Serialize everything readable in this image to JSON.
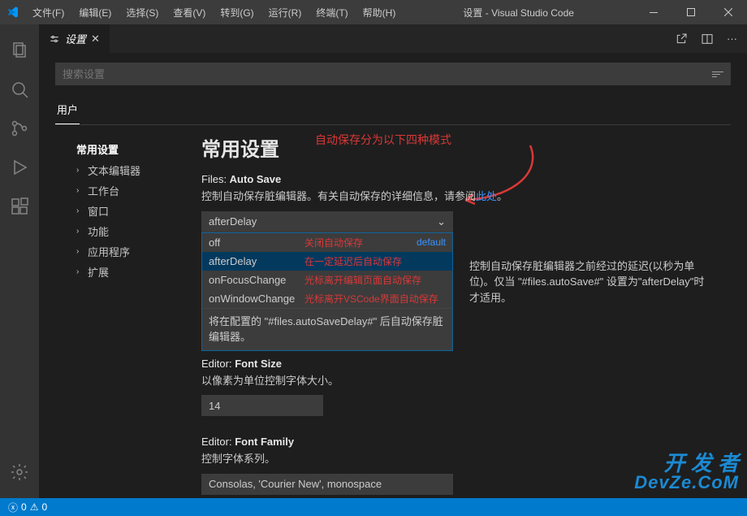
{
  "window": {
    "title": "设置 - Visual Studio Code"
  },
  "menu": [
    "文件(F)",
    "编辑(E)",
    "选择(S)",
    "查看(V)",
    "转到(G)",
    "运行(R)",
    "终端(T)",
    "帮助(H)"
  ],
  "tab": {
    "label": "设置"
  },
  "search": {
    "placeholder": "搜索设置"
  },
  "scope": {
    "user": "用户"
  },
  "toc": {
    "header": "常用设置",
    "items": [
      "文本编辑器",
      "工作台",
      "窗口",
      "功能",
      "应用程序",
      "扩展"
    ]
  },
  "group_title": "常用设置",
  "annotations": {
    "headline": "自动保存分为以下四种模式"
  },
  "autosave": {
    "label_cat": "Files: ",
    "label_name": "Auto Save",
    "desc_before": "控制自动保存脏编辑器。有关自动保存的详细信息，请参阅",
    "desc_link": "此处",
    "desc_after": "。",
    "value": "afterDelay",
    "options": [
      {
        "name": "off",
        "annot": "关闭自动保存",
        "default": "default"
      },
      {
        "name": "afterDelay",
        "annot": "在一定延迟后自动保存"
      },
      {
        "name": "onFocusChange",
        "annot": "光标离开编辑页面自动保存"
      },
      {
        "name": "onWindowChange",
        "annot": "光标离开VSCode界面自动保存"
      }
    ],
    "info": "将在配置的 \"#files.autoSaveDelay#\" 后自动保存脏编辑器。"
  },
  "autosave_delay": {
    "desc": "控制自动保存脏编辑器之前经过的延迟(以秒为单位)。仅当 \"#files.autoSave#\" 设置为\"afterDelay\"时才适用。"
  },
  "fontsize": {
    "label_cat": "Editor: ",
    "label_name": "Font Size",
    "desc": "以像素为单位控制字体大小。",
    "value": "14"
  },
  "fontfamily": {
    "label_cat": "Editor: ",
    "label_name": "Font Family",
    "desc": "控制字体系列。",
    "value": "Consolas, 'Courier New', monospace"
  },
  "statusbar": {
    "errors": "0",
    "warnings": "0"
  },
  "watermark": {
    "line1": "开 发 者",
    "line2": "DevZe.CoM"
  }
}
